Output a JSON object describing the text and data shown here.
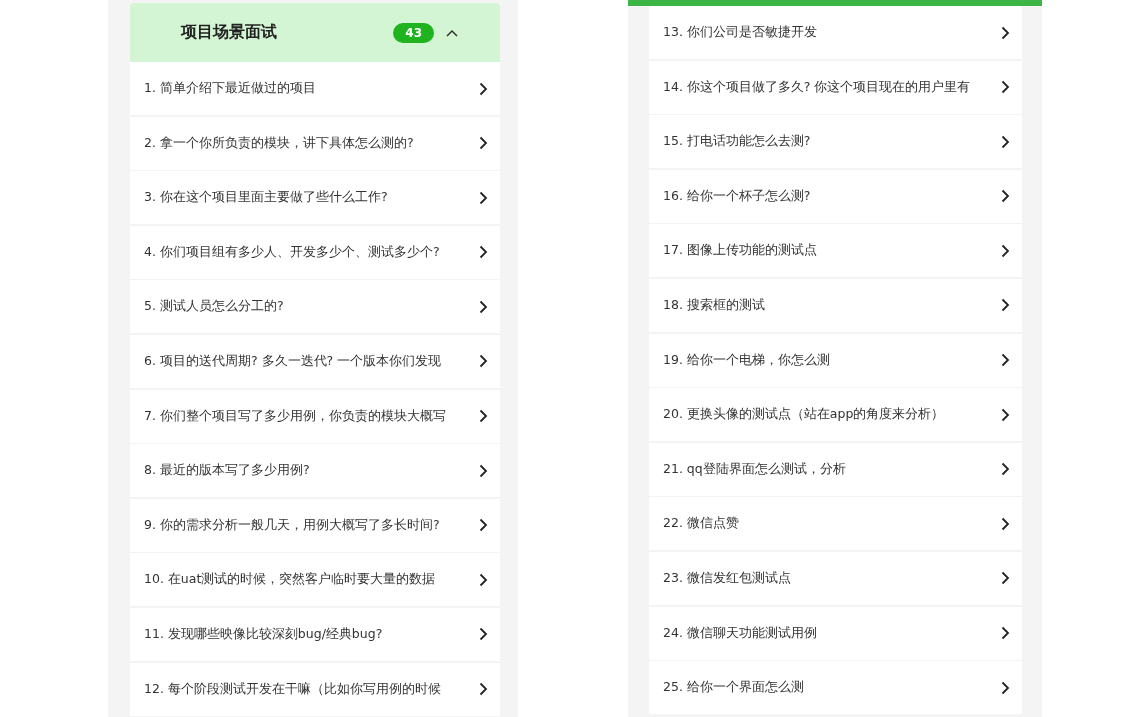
{
  "left_panel": {
    "header": {
      "title": "项目场景面试",
      "count": "43",
      "expanded": true
    },
    "items": [
      "1. 简单介绍下最近做过的项目",
      "2. 拿一个你所负责的模块，讲下具体怎么测的?",
      "3. 你在这个项目里面主要做了些什么工作?",
      "4. 你们项目组有多少人、开发多少个、测试多少个?",
      "5. 测试人员怎么分工的?",
      "6. 项目的送代周期? 多久一迭代? 一个版本你们发现",
      "7. 你们整个项目写了多少用例，你负责的模块大概写",
      "8. 最近的版本写了多少用例?",
      "9. 你的需求分析一般几天，用例大概写了多长时间?",
      "10. 在uat测试的时候，突然客户临时要大量的数据",
      "11. 发现哪些映像比较深刻bug/经典bug?",
      "12. 每个阶段测试开发在干嘛（比如你写用例的时候"
    ]
  },
  "right_panel": {
    "items": [
      "13. 你们公司是否敏捷开发",
      "14. 你这个项目做了多久? 你这个项目现在的用户里有",
      "15. 打电话功能怎么去测?",
      "16. 给你一个杯子怎么测?",
      "17. 图像上传功能的测试点",
      "18. 搜索框的测试",
      "19. 给你一个电梯，你怎么测",
      "20. 更换头像的测试点（站在app的角度来分析）",
      "21.  qq登陆界面怎么测试，分析",
      "22. 微信点赞",
      "23. 微信发红包测试点",
      "24. 微信聊天功能测试用例",
      "25. 给你一个界面怎么测"
    ]
  }
}
